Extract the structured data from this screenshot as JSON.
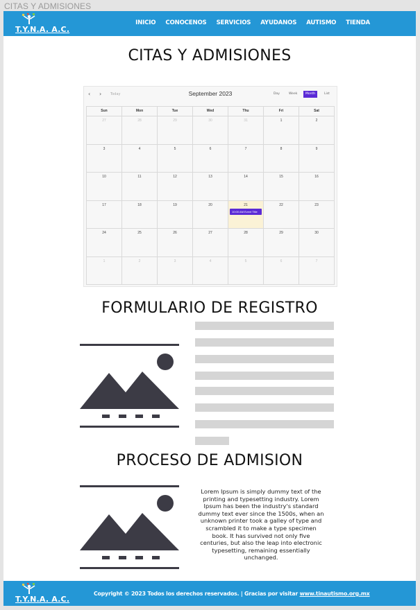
{
  "window": {
    "title": "CITAS Y ADMISIONES"
  },
  "header": {
    "logo_text": "T.Y.N.A. A.C.",
    "nav": [
      "INICIO",
      "CONOCENOS",
      "SERVICIOS",
      "AYUDANOS",
      "AUTISMO",
      "TIENDA"
    ]
  },
  "main": {
    "page_title": "CITAS Y ADMISIONES",
    "calendar": {
      "prev_label": "‹",
      "next_label": "›",
      "today_label": "Today",
      "title": "September 2023",
      "views": [
        "Day",
        "Week",
        "Month",
        "List"
      ],
      "active_view": "Month",
      "weekdays": [
        "Sun",
        "Mon",
        "Tue",
        "Wed",
        "Thu",
        "Fri",
        "Sat"
      ],
      "weeks": [
        [
          "27",
          "28",
          "29",
          "30",
          "31",
          "1",
          "2"
        ],
        [
          "3",
          "4",
          "5",
          "6",
          "7",
          "8",
          "9"
        ],
        [
          "10",
          "11",
          "12",
          "13",
          "14",
          "15",
          "16"
        ],
        [
          "17",
          "18",
          "19",
          "20",
          "21",
          "22",
          "23"
        ],
        [
          "24",
          "25",
          "26",
          "27",
          "28",
          "29",
          "30"
        ],
        [
          "1",
          "2",
          "3",
          "4",
          "5",
          "6",
          "7"
        ]
      ],
      "today": "21",
      "event": {
        "day": "21",
        "label": "10:00 AM Event Title"
      }
    },
    "registration": {
      "title": "FORMULARIO DE REGISTRO",
      "image_icon": "image-placeholder-icon",
      "field_count_visual": 8
    },
    "admission": {
      "title": "PROCESO DE ADMISION",
      "image_icon": "image-placeholder-icon",
      "body": "Lorem Ipsum is simply dummy text of the printing and typesetting industry. Lorem Ipsum has been the industry's standard dummy text ever since the 1500s, when an unknown printer took a galley of type and scrambled it to make a type specimen book. It has survived not only five centuries, but also the leap into electronic typesetting, remaining essentially unchanged."
    }
  },
  "footer": {
    "logo_text": "T.Y.N.A. A.C.",
    "copyright": "Copyright © 2023 Todos los derechos reservados. | Gracias por visitar ",
    "link": "www.tinautismo.org.mx"
  },
  "colors": {
    "brand_blue": "#2497d6",
    "event_purple": "#5b2bd6",
    "today_bg": "#fbf2d6",
    "placeholder_gray": "#d5d5d5",
    "icon_dark": "#3c3b45"
  }
}
